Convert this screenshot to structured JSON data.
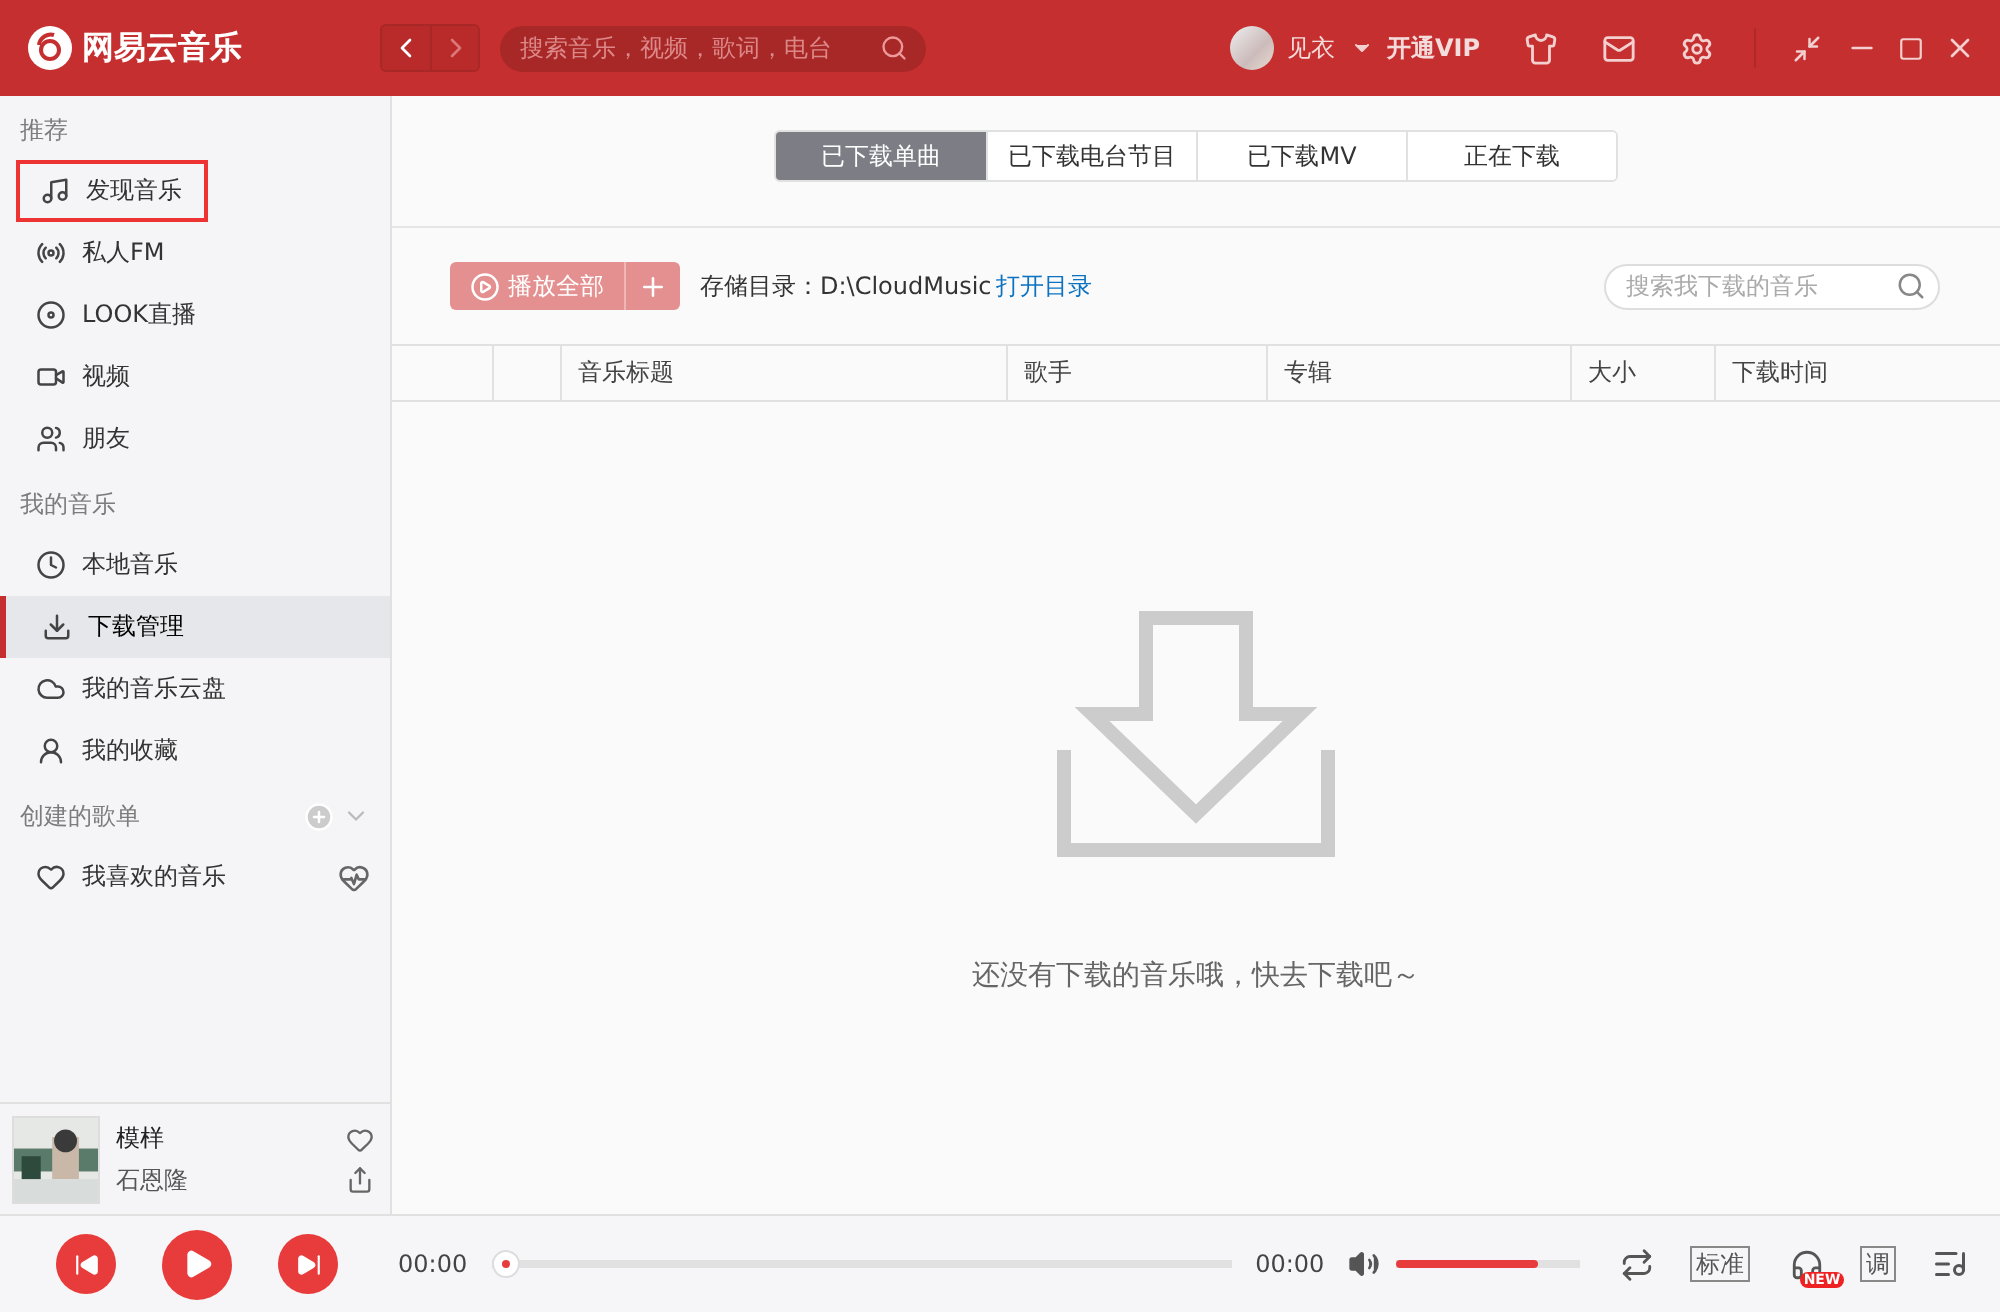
{
  "header": {
    "app_name": "网易云音乐",
    "search": {
      "placeholder": "搜索音乐，视频，歌词，电台"
    },
    "user_name": "见衣",
    "vip": "开通VIP"
  },
  "sidebar": {
    "sections": [
      {
        "title": "推荐",
        "items": [
          {
            "label": "发现音乐",
            "kind": "music",
            "selected": false,
            "highlighted": true
          },
          {
            "label": "私人FM",
            "kind": "radio",
            "selected": false,
            "highlighted": false
          },
          {
            "label": "LOOK直播",
            "kind": "live",
            "selected": false,
            "highlighted": false
          },
          {
            "label": "视频",
            "kind": "video",
            "selected": false,
            "highlighted": false
          },
          {
            "label": "朋友",
            "kind": "friends",
            "selected": false,
            "highlighted": false
          }
        ]
      },
      {
        "title": "我的音乐",
        "items": [
          {
            "label": "本地音乐",
            "kind": "local",
            "selected": false,
            "highlighted": false
          },
          {
            "label": "下载管理",
            "kind": "download",
            "selected": true,
            "highlighted": false
          },
          {
            "label": "我的音乐云盘",
            "kind": "cloud",
            "selected": false,
            "highlighted": false
          },
          {
            "label": "我的收藏",
            "kind": "collect",
            "selected": false,
            "highlighted": false
          }
        ]
      },
      {
        "title": "创建的歌单",
        "kind": "playlists",
        "items": [
          {
            "label": "我喜欢的音乐",
            "kind": "liked",
            "selected": false,
            "highlighted": false
          }
        ]
      }
    ]
  },
  "now_playing": {
    "title": "模样",
    "artist": "石恩隆"
  },
  "tabs": [
    {
      "label": "已下载单曲",
      "selected": true
    },
    {
      "label": "已下载电台节目",
      "selected": false
    },
    {
      "label": "已下载MV",
      "selected": false
    },
    {
      "label": "正在下载",
      "selected": false
    }
  ],
  "toolbar": {
    "play_all": "播放全部",
    "storage_label": "存储目录：D:\\CloudMusic",
    "open_folder": "打开目录",
    "search": {
      "placeholder": "搜索我下载的音乐"
    }
  },
  "table": {
    "columns": [
      "音乐标题",
      "歌手",
      "专辑",
      "大小",
      "下载时间"
    ]
  },
  "empty_message": "还没有下载的音乐哦，快去下载吧～",
  "player": {
    "elapsed": "00:00",
    "progress": {
      "level": 0
    },
    "total": "00:00",
    "volume": {
      "level": 0.77
    },
    "quality": "标准",
    "new_badge": "NEW",
    "equalizer": "调"
  }
}
